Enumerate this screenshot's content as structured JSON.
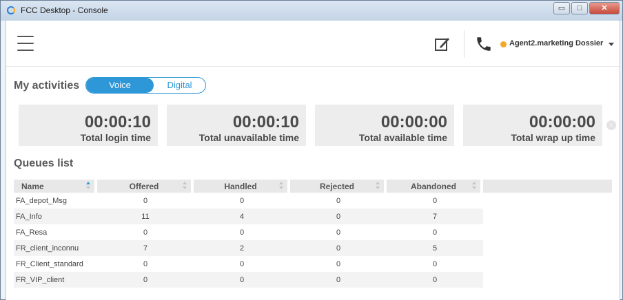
{
  "window": {
    "title": "FCC Desktop - Console",
    "min_label": "▭",
    "max_label": "□",
    "close_label": "✕"
  },
  "header": {
    "agent_status_color": "#f5a623",
    "agent_name": "Agent2.marketing Dossier",
    "icons": [
      "menu-icon",
      "edit-icon",
      "phone-icon",
      "chevron-down-icon"
    ]
  },
  "activities": {
    "title": "My activities",
    "toggle": {
      "voice": "Voice",
      "digital": "Digital",
      "selected": "Voice"
    },
    "cards": [
      {
        "value": "00:00:10",
        "label": "Total login time"
      },
      {
        "value": "00:00:10",
        "label": "Total unavailable time"
      },
      {
        "value": "00:00:00",
        "label": "Total available time"
      },
      {
        "value": "00:00:00",
        "label": "Total wrap up time"
      }
    ]
  },
  "queues": {
    "title": "Queues list",
    "columns": [
      "Name",
      "Offered",
      "Handled",
      "Rejected",
      "Abandoned"
    ],
    "rows": [
      [
        "FA_depot_Msg",
        "0",
        "0",
        "0",
        "0"
      ],
      [
        "FA_Info",
        "11",
        "4",
        "0",
        "7"
      ],
      [
        "FA_Resa",
        "0",
        "0",
        "0",
        "0"
      ],
      [
        "FR_client_inconnu",
        "7",
        "2",
        "0",
        "5"
      ],
      [
        "FR_Client_standard",
        "0",
        "0",
        "0",
        "0"
      ],
      [
        "FR_VIP_client",
        "0",
        "0",
        "0",
        "0"
      ]
    ]
  },
  "colors": {
    "accent": "#2e97d8",
    "status_away": "#f5a623"
  }
}
